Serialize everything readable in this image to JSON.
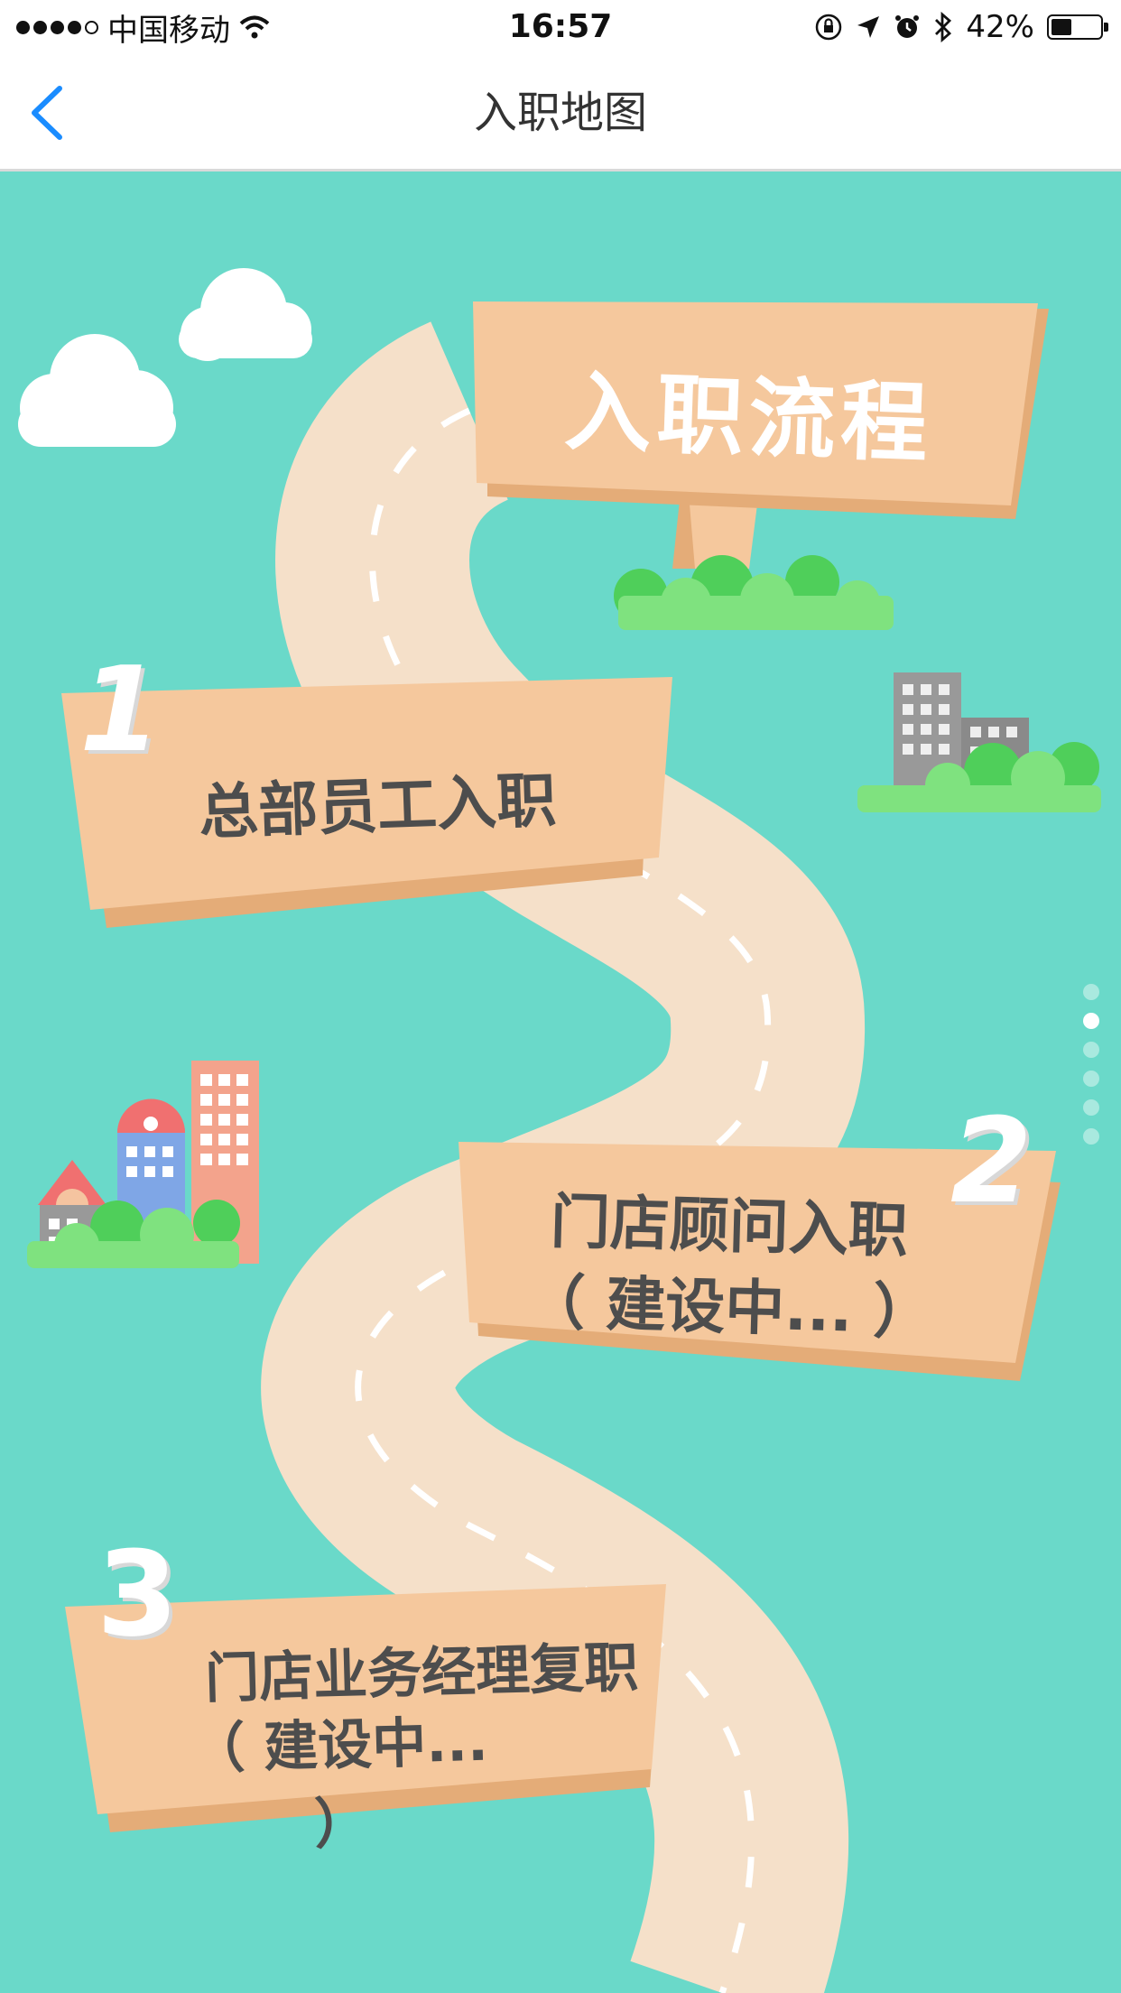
{
  "status_bar": {
    "carrier": "中国移动",
    "time": "16:57",
    "battery_percent": "42%",
    "battery_level": 0.42,
    "icons": [
      "signal-dots-icon",
      "wifi-icon",
      "orientation-lock-icon",
      "location-icon",
      "alarm-icon",
      "bluetooth-icon",
      "battery-icon"
    ]
  },
  "nav": {
    "title": "入职地图",
    "back_icon": "chevron-left-icon"
  },
  "map": {
    "header_sign": "入职流程",
    "steps": [
      {
        "number": "1",
        "label": "总部员工入职",
        "status": ""
      },
      {
        "number": "2",
        "label": "门店顾问入职",
        "status": "（ 建设中... ）"
      },
      {
        "number": "3",
        "label": "门店业务经理复职",
        "status": "（ 建设中... ）"
      }
    ],
    "page_indicator": {
      "count": 6,
      "active_index": 1
    }
  },
  "colors": {
    "background": "#6ad9c9",
    "road": "#f5e0c9",
    "sign": "#f5c89d",
    "sign_shadow": "#e4ac78",
    "accent_blue": "#1a8cff",
    "bush": "#7fe27f",
    "bush_dark": "#4fcf5a"
  }
}
